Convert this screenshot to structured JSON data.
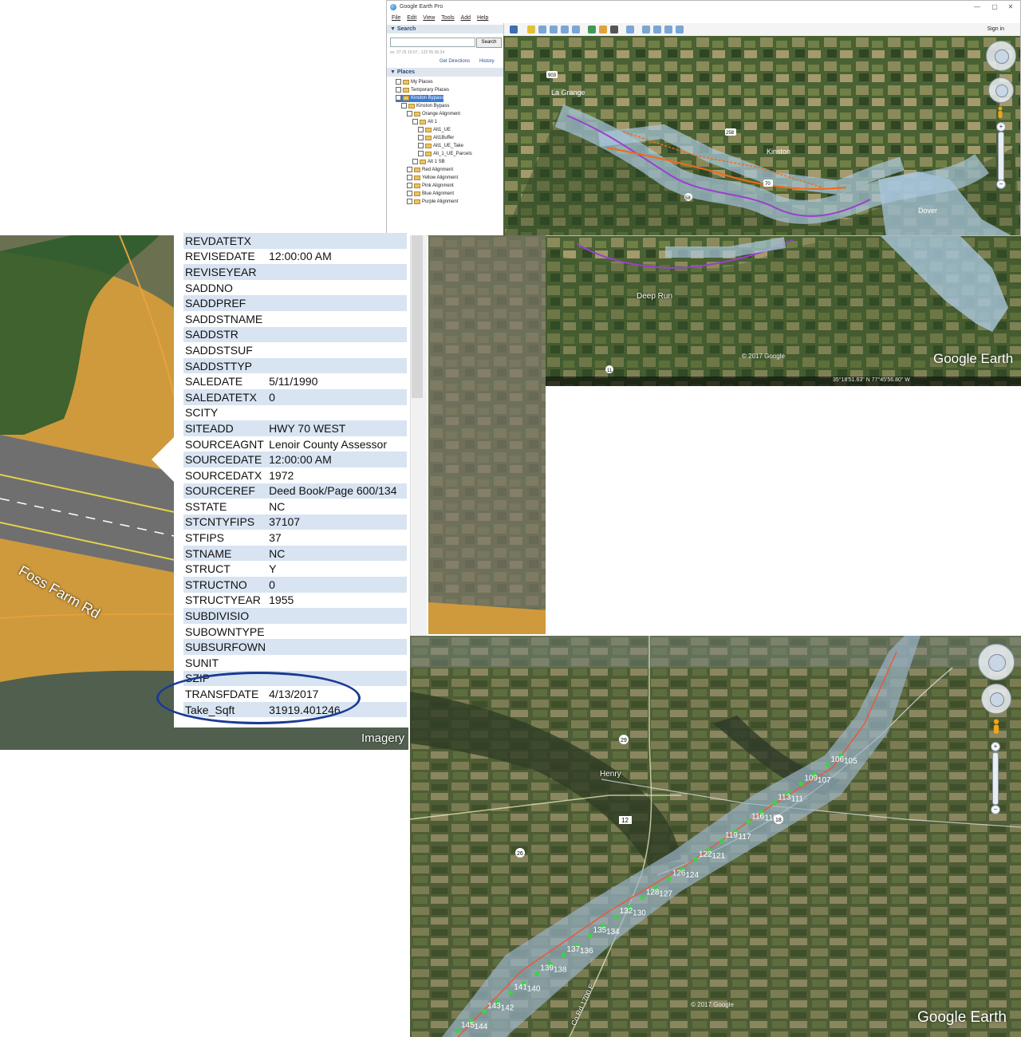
{
  "ge_window": {
    "title": "Google Earth Pro",
    "window_buttons": [
      "—",
      "▢",
      "✕"
    ],
    "menu": [
      "File",
      "Edit",
      "View",
      "Tools",
      "Add",
      "Help"
    ],
    "sign_in": "Sign in",
    "search_panel": {
      "header": "▼ Search",
      "button": "Search",
      "hint": "ex: 37 25 19.07, -122 05 06.24",
      "get_directions": "Get Directions",
      "history": "History"
    },
    "places_panel": {
      "header": "▼ Places",
      "items": [
        {
          "label": "My Places",
          "indent": 1
        },
        {
          "label": "Temporary Places",
          "indent": 1
        },
        {
          "label": "Kinston Bypass",
          "indent": 1,
          "selected": true
        },
        {
          "label": "Kinston Bypass",
          "indent": 2
        },
        {
          "label": "Orange Alignment",
          "indent": 3
        },
        {
          "label": "Alt 1",
          "indent": 4
        },
        {
          "label": "Alt1_UE",
          "indent": 5
        },
        {
          "label": "Alt1Buffer",
          "indent": 5
        },
        {
          "label": "Alt1_UE_Take",
          "indent": 5
        },
        {
          "label": "Alt_1_UE_Parcels",
          "indent": 5
        },
        {
          "label": "Alt 1 SB",
          "indent": 4
        },
        {
          "label": "Red Alignment",
          "indent": 3
        },
        {
          "label": "Yellow Alignment",
          "indent": 3
        },
        {
          "label": "Pink Alignment",
          "indent": 3
        },
        {
          "label": "Blue Alignment",
          "indent": 3
        },
        {
          "label": "Purple Alignment",
          "indent": 3
        }
      ]
    },
    "map": {
      "place_labels": [
        "La Grange",
        "Kinston",
        "Dover",
        "Deep Run"
      ],
      "route_shields": [
        "903",
        "58",
        "70",
        "258",
        "11"
      ],
      "copyright": "© 2017 Google",
      "coordinates": "35°18'51.63\" N   77°45'56.80\" W",
      "logo": "Google Earth"
    }
  },
  "attributes": {
    "rows": [
      {
        "key": "REVDATETX",
        "value": ""
      },
      {
        "key": "REVISEDATE",
        "value": "12:00:00 AM"
      },
      {
        "key": "REVISEYEAR",
        "value": ""
      },
      {
        "key": "SADDNO",
        "value": ""
      },
      {
        "key": "SADDPREF",
        "value": ""
      },
      {
        "key": "SADDSTNAME",
        "value": ""
      },
      {
        "key": "SADDSTR",
        "value": ""
      },
      {
        "key": "SADDSTSUF",
        "value": ""
      },
      {
        "key": "SADDSTTYP",
        "value": ""
      },
      {
        "key": "SALEDATE",
        "value": "5/11/1990"
      },
      {
        "key": "SALEDATETX",
        "value": "0"
      },
      {
        "key": "SCITY",
        "value": ""
      },
      {
        "key": "SITEADD",
        "value": "HWY 70 WEST"
      },
      {
        "key": "SOURCEAGNT",
        "value": "Lenoir County Assessor"
      },
      {
        "key": "SOURCEDATE",
        "value": "12:00:00 AM"
      },
      {
        "key": "SOURCEDATX",
        "value": "1972"
      },
      {
        "key": "SOURCEREF",
        "value": "Deed Book/Page 600/134"
      },
      {
        "key": "SSTATE",
        "value": "NC"
      },
      {
        "key": "STCNTYFIPS",
        "value": "37107"
      },
      {
        "key": "STFIPS",
        "value": "37"
      },
      {
        "key": "STNAME",
        "value": "NC"
      },
      {
        "key": "STRUCT",
        "value": "Y"
      },
      {
        "key": "STRUCTNO",
        "value": "0"
      },
      {
        "key": "STRUCTYEAR",
        "value": "1955"
      },
      {
        "key": "SUBDIVISIO",
        "value": ""
      },
      {
        "key": "SUBOWNTYPE",
        "value": ""
      },
      {
        "key": "SUBSURFOWN",
        "value": ""
      },
      {
        "key": "SUNIT",
        "value": ""
      },
      {
        "key": "SZIP",
        "value": ""
      },
      {
        "key": "TRANSFDATE",
        "value": "4/13/2017"
      },
      {
        "key": "Take_Sqft",
        "value": "31919.401246"
      }
    ]
  },
  "parcel_map": {
    "road_label": "Foss Farm Rd",
    "imagery_label": "Imagery"
  },
  "henry_view": {
    "town_label": "Henry",
    "route_shields": [
      "29",
      "12",
      "26",
      "18"
    ],
    "road_label": "Co Rd 1700 E",
    "station_labels": [
      "145",
      "144",
      "143",
      "142",
      "141",
      "140",
      "139",
      "138",
      "137",
      "136",
      "135",
      "134",
      "132",
      "130",
      "128",
      "127",
      "126",
      "124",
      "122",
      "121",
      "119",
      "117",
      "116",
      "115",
      "113",
      "111",
      "109",
      "107",
      "106",
      "105"
    ],
    "copyright": "© 2017 Google",
    "logo": "Google Earth"
  },
  "colors": {
    "highlight_ring": "#1b3a93",
    "parcel_fill": "#cf9a3c",
    "table_stripe": "#d8e4f2",
    "buffer_fill": "#a9c7dd",
    "alignment_purple": "#9a3fd0",
    "alignment_orange": "#f06a1a",
    "station_marker": "#3fd04a"
  }
}
